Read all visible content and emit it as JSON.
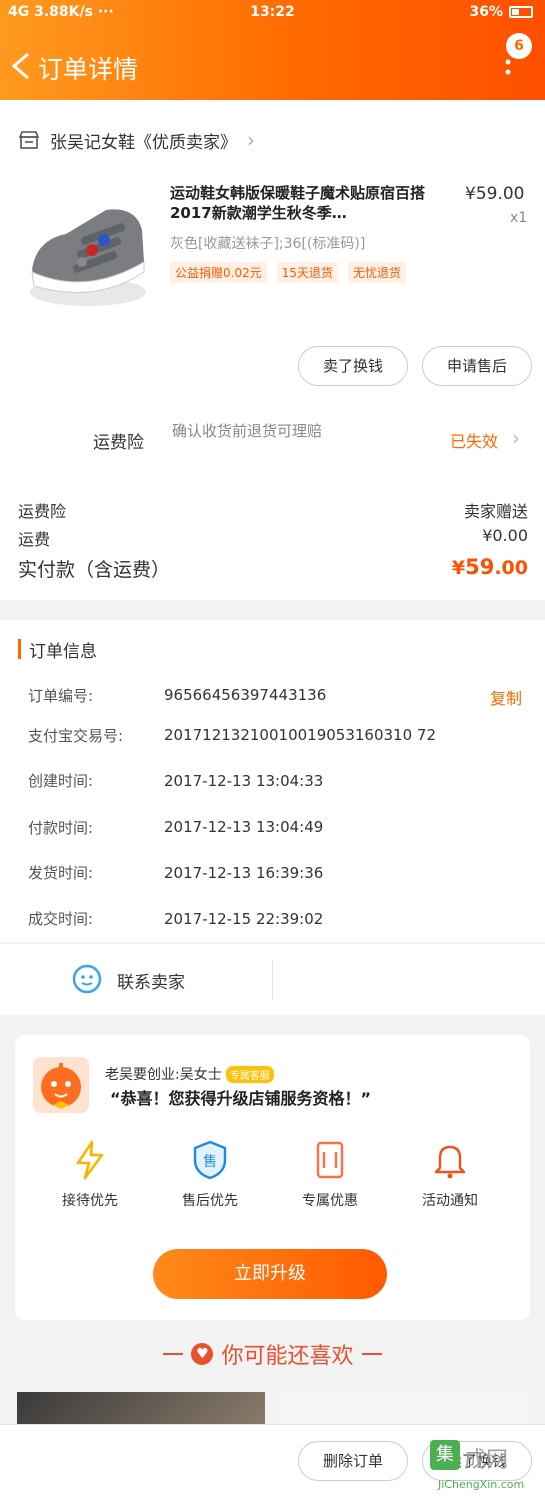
{
  "status_bar": {
    "left": "4G 3.88K/s ···",
    "time": "13:22",
    "battery": "36%"
  },
  "header": {
    "title": "订单详情",
    "badge": "6"
  },
  "shop": {
    "name": "张吴记女鞋《优质卖家》"
  },
  "product": {
    "title": "运动鞋女韩版保暖鞋子魔术贴原宿百搭2017新款潮学生秋冬季…",
    "price": "¥59.00",
    "qty": "x1",
    "sku": "灰色[收藏送袜子];36[(标准码)]",
    "tags": [
      "公益捐赠0.02元",
      "15天退货",
      "无忧退货"
    ]
  },
  "actions": {
    "sell_again": "卖了换钱",
    "after_sale": "申请售后"
  },
  "insurance": {
    "label": "运费险",
    "desc": "确认收货前退货可理赔",
    "status": "已失效"
  },
  "fees": {
    "insurance_label": "运费险",
    "insurance_value": "卖家赠送",
    "shipping_label": "运费",
    "shipping_value": "¥0.00",
    "total_label": "实付款（含运费）",
    "total_currency": "¥",
    "total_int": "59",
    "total_dec": ".00"
  },
  "order_info": {
    "title": "订单信息",
    "copy": "复制",
    "rows": [
      {
        "label": "订单编号:",
        "value": "96566456397443136"
      },
      {
        "label": "支付宝交易号:",
        "value": "20171213210010019053160310 72"
      },
      {
        "label": "创建时间:",
        "value": "2017-12-13  13:04:33"
      },
      {
        "label": "付款时间:",
        "value": "2017-12-13  13:04:49"
      },
      {
        "label": "发货时间:",
        "value": "2017-12-13  16:39:36"
      },
      {
        "label": "成交时间:",
        "value": "2017-12-15  22:39:02"
      }
    ]
  },
  "contact": {
    "label": "联系卖家"
  },
  "promo": {
    "subtitle": "老吴要创业:吴女士",
    "tag": "专属客服",
    "message": "“恭喜！您获得升级店铺服务资格！”",
    "perks": [
      "接待优先",
      "售后优先",
      "专属优惠",
      "活动通知"
    ],
    "upgrade": "立即升级"
  },
  "recommend": {
    "title": "你可能还喜欢"
  },
  "bottom": {
    "delete": "删除订单",
    "sell_again": "卖了换钱"
  },
  "watermark": {
    "logo": "集",
    "brand": "成网",
    "url": "JiChengXin.com"
  },
  "colors": {
    "accent": "#ff6a00",
    "price": "#ff5000"
  }
}
